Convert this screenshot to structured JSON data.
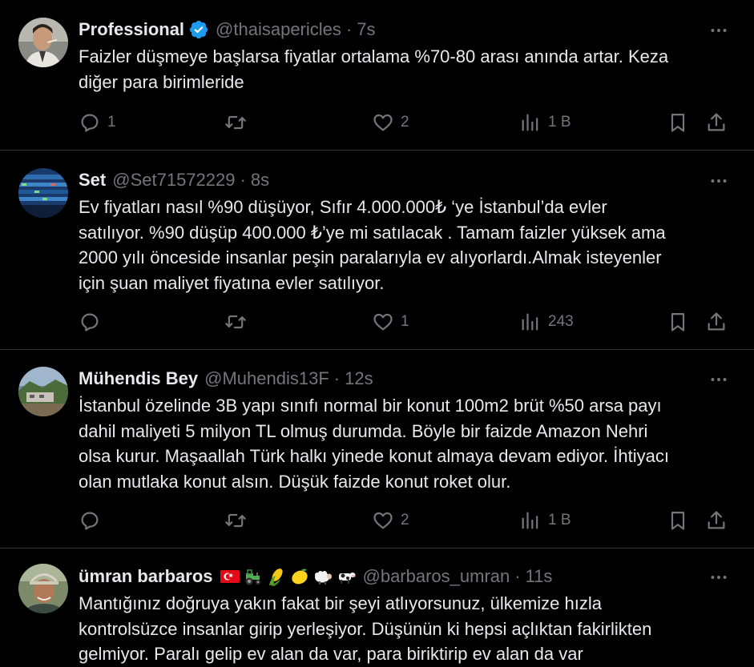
{
  "tweets": [
    {
      "name": "Professional",
      "verified": true,
      "handle": "@thaisapericles",
      "separator": "·",
      "time": "7s",
      "text": "Faizler düşmeye başlarsa fiyatlar ortalama %70-80 arası anında artar. Keza\ndiğer para birimleride",
      "replies": "1",
      "retweets": "",
      "likes": "2",
      "views": "1 B",
      "avatar": "man-portrait-avatar"
    },
    {
      "name": "Set",
      "verified": false,
      "handle": "@Set71572229",
      "separator": "·",
      "time": "8s",
      "text": "Ev fiyatları nasıl %90 düşüyor, Sıfır 4.000.000₺ ‘ye İstanbul’da evler\nsatılıyor. %90 düşüp 400.000 ₺’ye mi satılacak . Tamam faizler yüksek ama\n2000 yılı önceside insanlar peşin paralarıyla ev alıyorlardı.Almak isteyenler\niçin şuan maliyet fiyatına evler satılıyor.",
      "replies": "",
      "retweets": "",
      "likes": "1",
      "views": "243",
      "avatar": "stock-board-avatar"
    },
    {
      "name": "Mühendis Bey",
      "verified": false,
      "handle": "@Muhendis13F",
      "separator": "·",
      "time": "12s",
      "text": "İstanbul özelinde 3B yapı sınıfı normal bir konut 100m2 brüt %50 arsa payı\ndahil maliyeti 5 milyon TL olmuş durumda. Böyle bir faizde Amazon Nehri\nolsa kurur. Maşaallah Türk halkı yinede konut almaya devam ediyor. İhtiyacı\nolan mutlaka konut alsın. Düşük faizde konut roket olur.",
      "replies": "",
      "retweets": "",
      "likes": "2",
      "views": "1 B",
      "avatar": "landscape-avatar"
    },
    {
      "name": "ümran barbaros",
      "verified": false,
      "handle": "@barbaros_umran",
      "separator": "·",
      "time": "11s",
      "emojis": [
        "turkey-flag-icon",
        "tractor-icon",
        "corn-icon",
        "lemon-icon",
        "sheep-icon",
        "cow-icon"
      ],
      "text": "Mantığınız doğruya yakın fakat bir şeyi atlıyorsunuz, ülkemize hızla\nkontrolsüzce insanlar girip yerleşiyor. Düşünün ki hepsi açlıktan fakirlikten\ngelmiyor. Paralı gelip ev alan da var, para biriktirip ev alan da var",
      "avatar": "man-with-cap-avatar"
    }
  ],
  "colors": {
    "background": "#000000",
    "text": "#e7e9ea",
    "muted": "#71767b",
    "divider": "#2f3336",
    "verified": "#1d9bf0"
  }
}
